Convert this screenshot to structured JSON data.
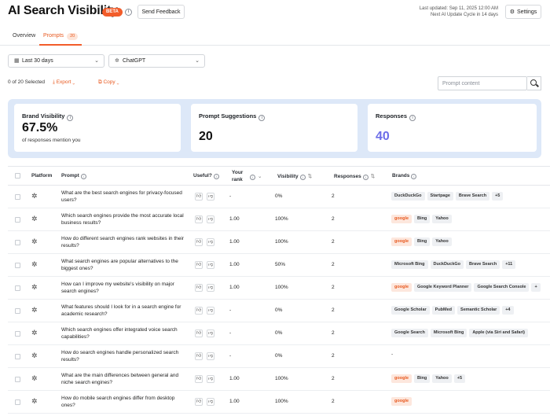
{
  "header": {
    "title": "AI Search Visibility",
    "beta": "BETA",
    "feedback_label": "Send Feedback",
    "last_updated": "Last updated: Sep 11, 2025 12:00 AM",
    "next_cycle": "Next AI Update Cycle in 14 days",
    "settings_label": "Settings"
  },
  "tabs": [
    {
      "label": "Overview"
    },
    {
      "label": "Prompts",
      "count": "20"
    }
  ],
  "filters": {
    "date_range": "Last 30 days",
    "model": "ChatGPT"
  },
  "bulk": {
    "selected": "0 of 20 Selected",
    "export_label": "Export",
    "copy_label": "Copy"
  },
  "search": {
    "placeholder": "Prompt content"
  },
  "stats": {
    "brand_visibility": {
      "title": "Brand Visibility",
      "value": "67.5%",
      "subtitle": "of responses mention you"
    },
    "prompt_suggestions": {
      "title": "Prompt Suggestions",
      "value": "20"
    },
    "responses": {
      "title": "Responses",
      "value": "40"
    }
  },
  "table": {
    "headers": {
      "platform": "Platform",
      "prompt": "Prompt",
      "useful": "Useful?",
      "rank_line1": "Your",
      "rank_line2": "rank",
      "visibility": "Visibility",
      "responses": "Responses",
      "brands": "Brands"
    },
    "rows": [
      {
        "prompt": "What are the best search engines for privacy-focused users?",
        "rank": "-",
        "visibility": "0%",
        "responses": "2",
        "brands": [
          {
            "name": "DuckDuckGo",
            "hl": false
          },
          {
            "name": "Startpage",
            "hl": false
          },
          {
            "name": "Brave Search",
            "hl": false
          },
          {
            "name": "+5",
            "hl": false
          }
        ]
      },
      {
        "prompt": "Which search engines provide the most accurate local business results?",
        "rank": "1.00",
        "visibility": "100%",
        "responses": "2",
        "brands": [
          {
            "name": "google",
            "hl": true
          },
          {
            "name": "Bing",
            "hl": false
          },
          {
            "name": "Yahoo",
            "hl": false
          }
        ]
      },
      {
        "prompt": "How do different search engines rank websites in their results?",
        "rank": "1.00",
        "visibility": "100%",
        "responses": "2",
        "brands": [
          {
            "name": "google",
            "hl": true
          },
          {
            "name": "Bing",
            "hl": false
          },
          {
            "name": "Yahoo",
            "hl": false
          }
        ]
      },
      {
        "prompt": "What search engines are popular alternatives to the biggest ones?",
        "rank": "1.00",
        "visibility": "50%",
        "responses": "2",
        "brands": [
          {
            "name": "Microsoft Bing",
            "hl": false
          },
          {
            "name": "DuckDuckGo",
            "hl": false
          },
          {
            "name": "Brave Search",
            "hl": false
          },
          {
            "name": "+11",
            "hl": false
          }
        ]
      },
      {
        "prompt": "How can I improve my website's visibility on major search engines?",
        "rank": "1.00",
        "visibility": "100%",
        "responses": "2",
        "brands": [
          {
            "name": "google",
            "hl": true
          },
          {
            "name": "Google Keyword Planner",
            "hl": false
          },
          {
            "name": "Google Search Console",
            "hl": false
          },
          {
            "name": "+",
            "hl": false
          }
        ]
      },
      {
        "prompt": "What features should I look for in a search engine for academic research?",
        "rank": "-",
        "visibility": "0%",
        "responses": "2",
        "brands": [
          {
            "name": "Google Scholar",
            "hl": false
          },
          {
            "name": "PubMed",
            "hl": false
          },
          {
            "name": "Semantic Scholar",
            "hl": false
          },
          {
            "name": "+4",
            "hl": false
          }
        ]
      },
      {
        "prompt": "Which search engines offer integrated voice search capabilities?",
        "rank": "-",
        "visibility": "0%",
        "responses": "2",
        "brands": [
          {
            "name": "Google Search",
            "hl": false
          },
          {
            "name": "Microsoft Bing",
            "hl": false
          },
          {
            "name": "Apple (via Siri and Safari)",
            "hl": false
          }
        ]
      },
      {
        "prompt": "How do search engines handle personalized search results?",
        "rank": "-",
        "visibility": "0%",
        "responses": "2",
        "brands": []
      },
      {
        "prompt": "What are the main differences between general and niche search engines?",
        "rank": "1.00",
        "visibility": "100%",
        "responses": "2",
        "brands": [
          {
            "name": "google",
            "hl": true
          },
          {
            "name": "Bing",
            "hl": false
          },
          {
            "name": "Yahoo",
            "hl": false
          },
          {
            "name": "+5",
            "hl": false
          }
        ]
      },
      {
        "prompt": "How do mobile search engines differ from desktop ones?",
        "rank": "1.00",
        "visibility": "100%",
        "responses": "2",
        "brands": [
          {
            "name": "google",
            "hl": true
          }
        ]
      }
    ]
  },
  "colors": {
    "accent": "#f25c2a",
    "stats_bg": "#dde8f8",
    "responses_value": "#6d6ee8"
  }
}
